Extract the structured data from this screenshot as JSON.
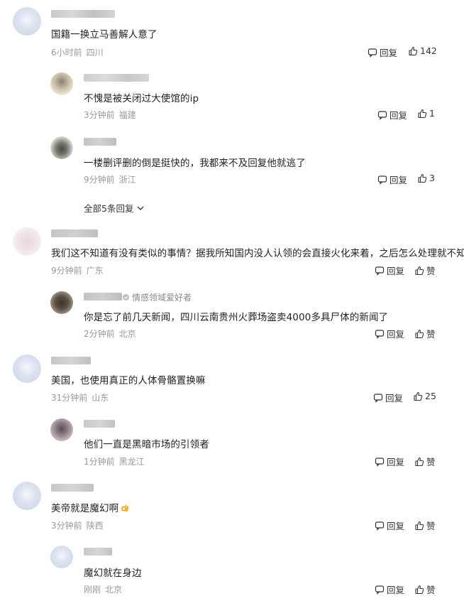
{
  "colors": {
    "text": "#222222",
    "meta": "#999999",
    "action": "#333333"
  },
  "comments": [
    {
      "text": "国籍一换立马善解人意了",
      "time": "6小时前",
      "location": "四川",
      "reply_label": "回复",
      "likes": "142",
      "replies": [
        {
          "text": "不愧是被关闭过大使馆的ip",
          "time": "3分钟前",
          "location": "福建",
          "reply_label": "回复",
          "likes": "1"
        },
        {
          "text": "一楼删评删的倒是挺快的，我都来不及回复他就逃了",
          "time": "9分钟前",
          "location": "浙江",
          "reply_label": "回复",
          "likes": "3"
        }
      ],
      "expand_label": "全部5条回复"
    },
    {
      "text": "我们这不知道有没有类似的事情？据我所知国内没人认领的会直接火化来着，之后怎么处理就不知道了",
      "time": "9分钟前",
      "location": "广东",
      "reply_label": "回复",
      "likes": "赞",
      "replies": [
        {
          "badge": "情感领域爱好者",
          "text": "你是忘了前几天新闻，四川云南贵州火葬场盗卖4000多具尸体的新闻了",
          "time": "2分钟前",
          "location": "北京",
          "reply_label": "回复",
          "likes": "赞"
        }
      ]
    },
    {
      "text": "美国，也使用真正的人体骨骼置换嘛",
      "time": "31分钟前",
      "location": "山东",
      "reply_label": "回复",
      "likes": "25",
      "replies": [
        {
          "text": "他们一直是黑暗市场的引领者",
          "time": "1分钟前",
          "location": "黑龙江",
          "reply_label": "回复",
          "likes": "赞"
        }
      ]
    },
    {
      "text": "美帝就是魔幻啊",
      "time": "3分钟前",
      "location": "陕西",
      "reply_label": "回复",
      "likes": "赞",
      "replies": [
        {
          "text": "魔幻就在身边",
          "time": "刚刚",
          "location": "北京",
          "reply_label": "回复",
          "likes": "赞"
        }
      ]
    }
  ]
}
